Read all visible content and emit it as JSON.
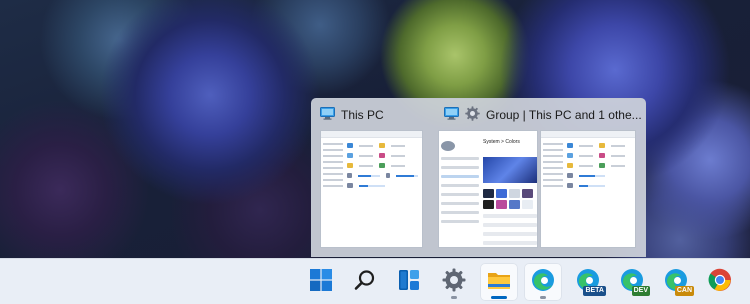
{
  "wallpaper": {
    "description_icon": "flower-wallpaper"
  },
  "flyout": {
    "card1": {
      "title": "This PC",
      "icon": "monitor-icon"
    },
    "card2": {
      "title": "Group | This PC and 1 othe...",
      "icons": [
        "monitor-icon",
        "gear-icon"
      ]
    },
    "thumb_settings_heading": "System > Colors"
  },
  "taskbar": {
    "items": [
      {
        "name": "start",
        "icon": "windows-logo-icon"
      },
      {
        "name": "search",
        "icon": "search-icon"
      },
      {
        "name": "widgets",
        "icon": "widgets-icon"
      },
      {
        "name": "settings",
        "icon": "gear-icon",
        "running": true
      },
      {
        "name": "file-explorer",
        "icon": "folder-icon",
        "running": true,
        "active": true
      },
      {
        "name": "edge",
        "icon": "edge-icon",
        "running": true,
        "active": true
      },
      {
        "name": "edge-beta",
        "icon": "edge-beta-icon",
        "badge": "BETA"
      },
      {
        "name": "edge-dev",
        "icon": "edge-dev-icon",
        "badge": "DEV"
      },
      {
        "name": "edge-canary",
        "icon": "edge-canary-icon",
        "badge": "CAN"
      },
      {
        "name": "chrome",
        "icon": "chrome-icon"
      }
    ],
    "colors": {
      "accent": "#0067c0",
      "beta": "#1a4f8a",
      "dev": "#2e7d32",
      "canary": "#c98a0a"
    }
  }
}
